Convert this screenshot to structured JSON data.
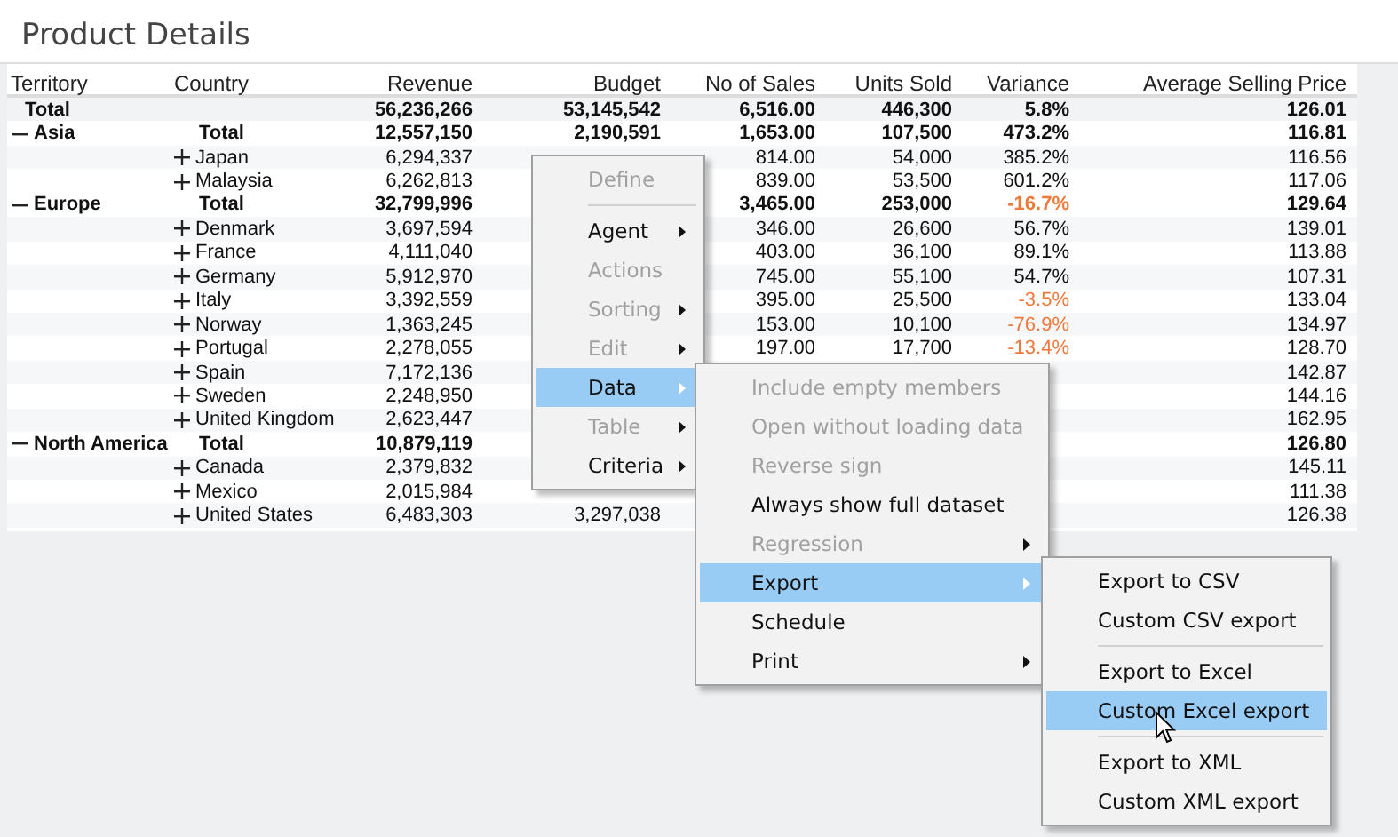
{
  "title": "Product Details",
  "table": {
    "columns": [
      "Territory",
      "Country",
      "Revenue",
      "Budget",
      "No of Sales",
      "Units Sold",
      "Variance",
      "Average Selling Price"
    ],
    "grand_total": {
      "label": "Total",
      "revenue": "56,236,266",
      "budget": "53,145,542",
      "sales": "6,516.00",
      "units": "446,300",
      "variance": "5.8%",
      "variance_negative": false,
      "asp": "126.01"
    },
    "groups": [
      {
        "territory": "Asia",
        "expanded": true,
        "rows": [
          {
            "kind": "total",
            "country": "Total",
            "revenue": "12,557,150",
            "budget": "2,190,591",
            "sales": "1,653.00",
            "units": "107,500",
            "variance": "473.2%",
            "variance_negative": false,
            "asp": "116.81"
          },
          {
            "kind": "member",
            "expanded": false,
            "country": "Japan",
            "revenue": "6,294,337",
            "sales": "814.00",
            "units": "54,000",
            "variance": "385.2%",
            "variance_negative": false,
            "asp": "116.56"
          },
          {
            "kind": "member",
            "expanded": false,
            "country": "Malaysia",
            "revenue": "6,262,813",
            "sales": "839.00",
            "units": "53,500",
            "variance": "601.2%",
            "variance_negative": false,
            "asp": "117.06"
          }
        ]
      },
      {
        "territory": "Europe",
        "expanded": true,
        "rows": [
          {
            "kind": "total",
            "country": "Total",
            "revenue": "32,799,996",
            "sales": "3,465.00",
            "units": "253,000",
            "variance": "-16.7%",
            "variance_negative": true,
            "asp": "129.64"
          },
          {
            "kind": "member",
            "expanded": false,
            "country": "Denmark",
            "revenue": "3,697,594",
            "sales": "346.00",
            "units": "26,600",
            "variance": "56.7%",
            "variance_negative": false,
            "asp": "139.01"
          },
          {
            "kind": "member",
            "expanded": false,
            "country": "France",
            "revenue": "4,111,040",
            "sales": "403.00",
            "units": "36,100",
            "variance": "89.1%",
            "variance_negative": false,
            "asp": "113.88"
          },
          {
            "kind": "member",
            "expanded": false,
            "country": "Germany",
            "revenue": "5,912,970",
            "sales": "745.00",
            "units": "55,100",
            "variance": "54.7%",
            "variance_negative": false,
            "asp": "107.31"
          },
          {
            "kind": "member",
            "expanded": false,
            "country": "Italy",
            "revenue": "3,392,559",
            "sales": "395.00",
            "units": "25,500",
            "variance": "-3.5%",
            "variance_negative": true,
            "asp": "133.04"
          },
          {
            "kind": "member",
            "expanded": false,
            "country": "Norway",
            "revenue": "1,363,245",
            "sales": "153.00",
            "units": "10,100",
            "variance": "-76.9%",
            "variance_negative": true,
            "asp": "134.97"
          },
          {
            "kind": "member",
            "expanded": false,
            "country": "Portugal",
            "revenue": "2,278,055",
            "sales": "197.00",
            "units": "17,700",
            "variance": "-13.4%",
            "variance_negative": true,
            "asp": "128.70"
          },
          {
            "kind": "member",
            "expanded": false,
            "country": "Spain",
            "revenue": "7,172,136",
            "asp": "142.87"
          },
          {
            "kind": "member",
            "expanded": false,
            "country": "Sweden",
            "revenue": "2,248,950",
            "asp": "144.16"
          },
          {
            "kind": "member",
            "expanded": false,
            "country": "United Kingdom",
            "revenue": "2,623,447",
            "asp": "162.95"
          }
        ]
      },
      {
        "territory": "North America",
        "expanded": true,
        "rows": [
          {
            "kind": "total",
            "country": "Total",
            "revenue": "10,879,119",
            "asp": "126.80"
          },
          {
            "kind": "member",
            "expanded": false,
            "country": "Canada",
            "revenue": "2,379,832",
            "asp": "145.11"
          },
          {
            "kind": "member",
            "expanded": false,
            "country": "Mexico",
            "revenue": "2,015,984",
            "asp": "111.38"
          },
          {
            "kind": "member",
            "expanded": false,
            "country": "United States",
            "revenue": "6,483,303",
            "budget": "3,297,038",
            "asp": "126.38"
          }
        ]
      }
    ]
  },
  "context_menu": {
    "items": [
      {
        "label": "Define",
        "disabled": true,
        "submenu": false,
        "selected": false,
        "separator_after": true
      },
      {
        "label": "Agent",
        "disabled": false,
        "submenu": true,
        "selected": false,
        "separator_after": false
      },
      {
        "label": "Actions",
        "disabled": true,
        "submenu": false,
        "selected": false,
        "separator_after": false
      },
      {
        "label": "Sorting",
        "disabled": true,
        "submenu": true,
        "selected": false,
        "separator_after": false
      },
      {
        "label": "Edit",
        "disabled": true,
        "submenu": true,
        "selected": false,
        "separator_after": false
      },
      {
        "label": "Data",
        "disabled": false,
        "submenu": true,
        "selected": true,
        "separator_after": false
      },
      {
        "label": "Table",
        "disabled": true,
        "submenu": true,
        "selected": false,
        "separator_after": false
      },
      {
        "label": "Criteria",
        "disabled": false,
        "submenu": true,
        "selected": false,
        "separator_after": false
      }
    ]
  },
  "data_submenu": {
    "items": [
      {
        "label": "Include empty members",
        "disabled": true,
        "submenu": false,
        "selected": false,
        "separator_after": false
      },
      {
        "label": "Open without loading data",
        "disabled": true,
        "submenu": false,
        "selected": false,
        "separator_after": false
      },
      {
        "label": "Reverse sign",
        "disabled": true,
        "submenu": false,
        "selected": false,
        "separator_after": false
      },
      {
        "label": "Always show full dataset",
        "disabled": false,
        "submenu": false,
        "selected": false,
        "separator_after": false
      },
      {
        "label": "Regression",
        "disabled": true,
        "submenu": true,
        "selected": false,
        "separator_after": false
      },
      {
        "label": "Export",
        "disabled": false,
        "submenu": true,
        "selected": true,
        "separator_after": false
      },
      {
        "label": "Schedule",
        "disabled": false,
        "submenu": false,
        "selected": false,
        "separator_after": false
      },
      {
        "label": "Print",
        "disabled": false,
        "submenu": true,
        "selected": false,
        "separator_after": false
      }
    ]
  },
  "export_submenu": {
    "items": [
      {
        "label": "Export to CSV",
        "disabled": false,
        "submenu": false,
        "selected": false,
        "separator_after": false
      },
      {
        "label": "Custom CSV export",
        "disabled": false,
        "submenu": false,
        "selected": false,
        "separator_after": true
      },
      {
        "label": "Export to Excel",
        "disabled": false,
        "submenu": false,
        "selected": false,
        "separator_after": false
      },
      {
        "label": "Custom Excel export",
        "disabled": false,
        "submenu": false,
        "selected": true,
        "separator_after": true
      },
      {
        "label": "Export to XML",
        "disabled": false,
        "submenu": false,
        "selected": false,
        "separator_after": false
      },
      {
        "label": "Custom XML export",
        "disabled": false,
        "submenu": false,
        "selected": false,
        "separator_after": false
      }
    ]
  }
}
